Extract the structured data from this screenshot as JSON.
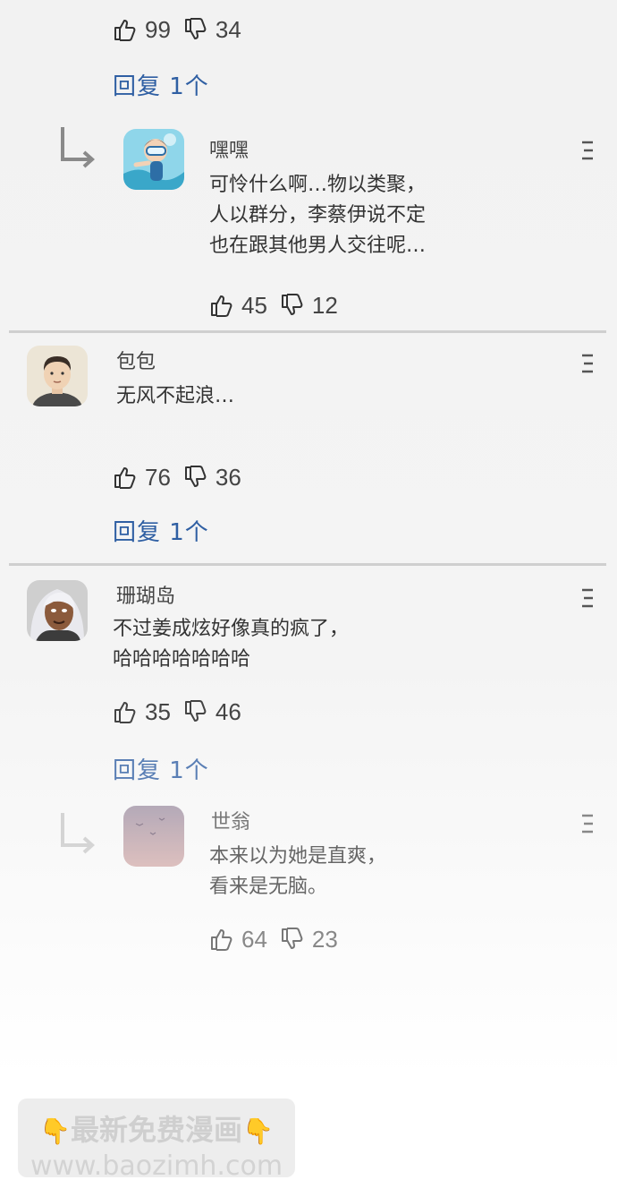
{
  "comments": [
    {
      "id": "top-partial",
      "likes": "99",
      "dislikes": "34",
      "reply_link": "回复 1个",
      "reply": {
        "name": "嘿嘿",
        "text": "可怜什么啊…物以类聚，\n人以群分，李蔡伊说不定\n也在跟其他男人交往呢…",
        "likes": "45",
        "dislikes": "12"
      }
    },
    {
      "id": "baobao",
      "name": "包包",
      "text": "无风不起浪…",
      "likes": "76",
      "dislikes": "36",
      "reply_link": "回复 1个"
    },
    {
      "id": "shanhudao",
      "name": "珊瑚岛",
      "text": "不过姜成炫好像真的疯了，\n哈哈哈哈哈哈哈",
      "likes": "35",
      "dislikes": "46",
      "reply_link": "回复 1个",
      "reply": {
        "name": "世翁",
        "text": "本来以为她是直爽，\n看来是无脑。",
        "likes": "64",
        "dislikes": "23"
      }
    }
  ],
  "watermark": {
    "line1": "最新免费漫画",
    "line2": "www.baozimh.com",
    "emoji": "👇"
  },
  "colors": {
    "reply_link": "#2f5fa3",
    "divider": "#cfcfcf"
  }
}
